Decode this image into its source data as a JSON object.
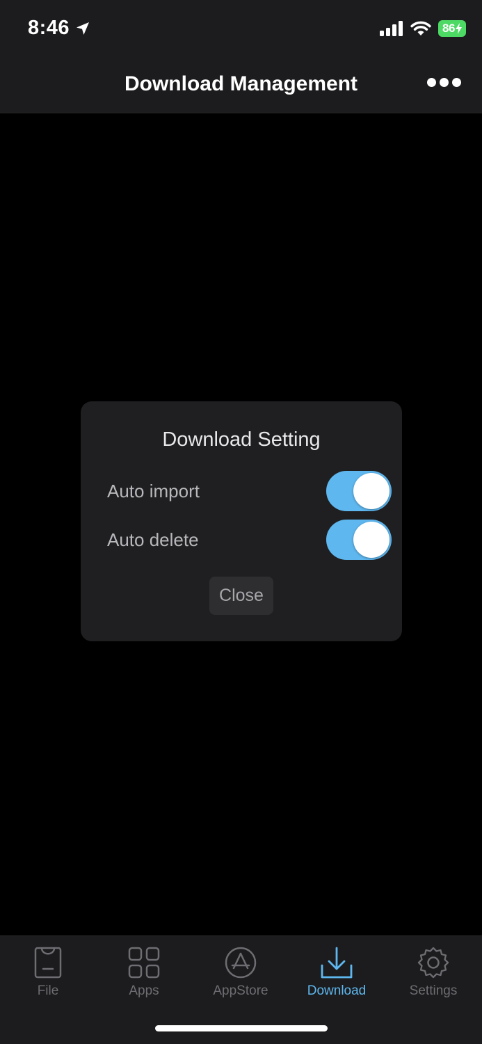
{
  "status_bar": {
    "time": "8:46",
    "battery": "86"
  },
  "nav": {
    "title": "Download Management"
  },
  "dialog": {
    "title": "Download Setting",
    "settings": [
      {
        "label": "Auto import",
        "enabled": true
      },
      {
        "label": "Auto delete",
        "enabled": true
      }
    ],
    "close_label": "Close"
  },
  "tabbar": {
    "active_tab": "Download",
    "tabs": [
      {
        "label": "File",
        "icon": "bag-icon"
      },
      {
        "label": "Apps",
        "icon": "grid-icon"
      },
      {
        "label": "AppStore",
        "icon": "appstore-icon"
      },
      {
        "label": "Download",
        "icon": "download-icon"
      },
      {
        "label": "Settings",
        "icon": "gear-icon"
      }
    ]
  },
  "colors": {
    "accent": "#5eb7ef",
    "battery": "#4cd964",
    "background": "#000000",
    "bar_background": "#1c1c1e",
    "dialog_background": "#1f1f21",
    "inactive_tab": "#6d6d72"
  }
}
